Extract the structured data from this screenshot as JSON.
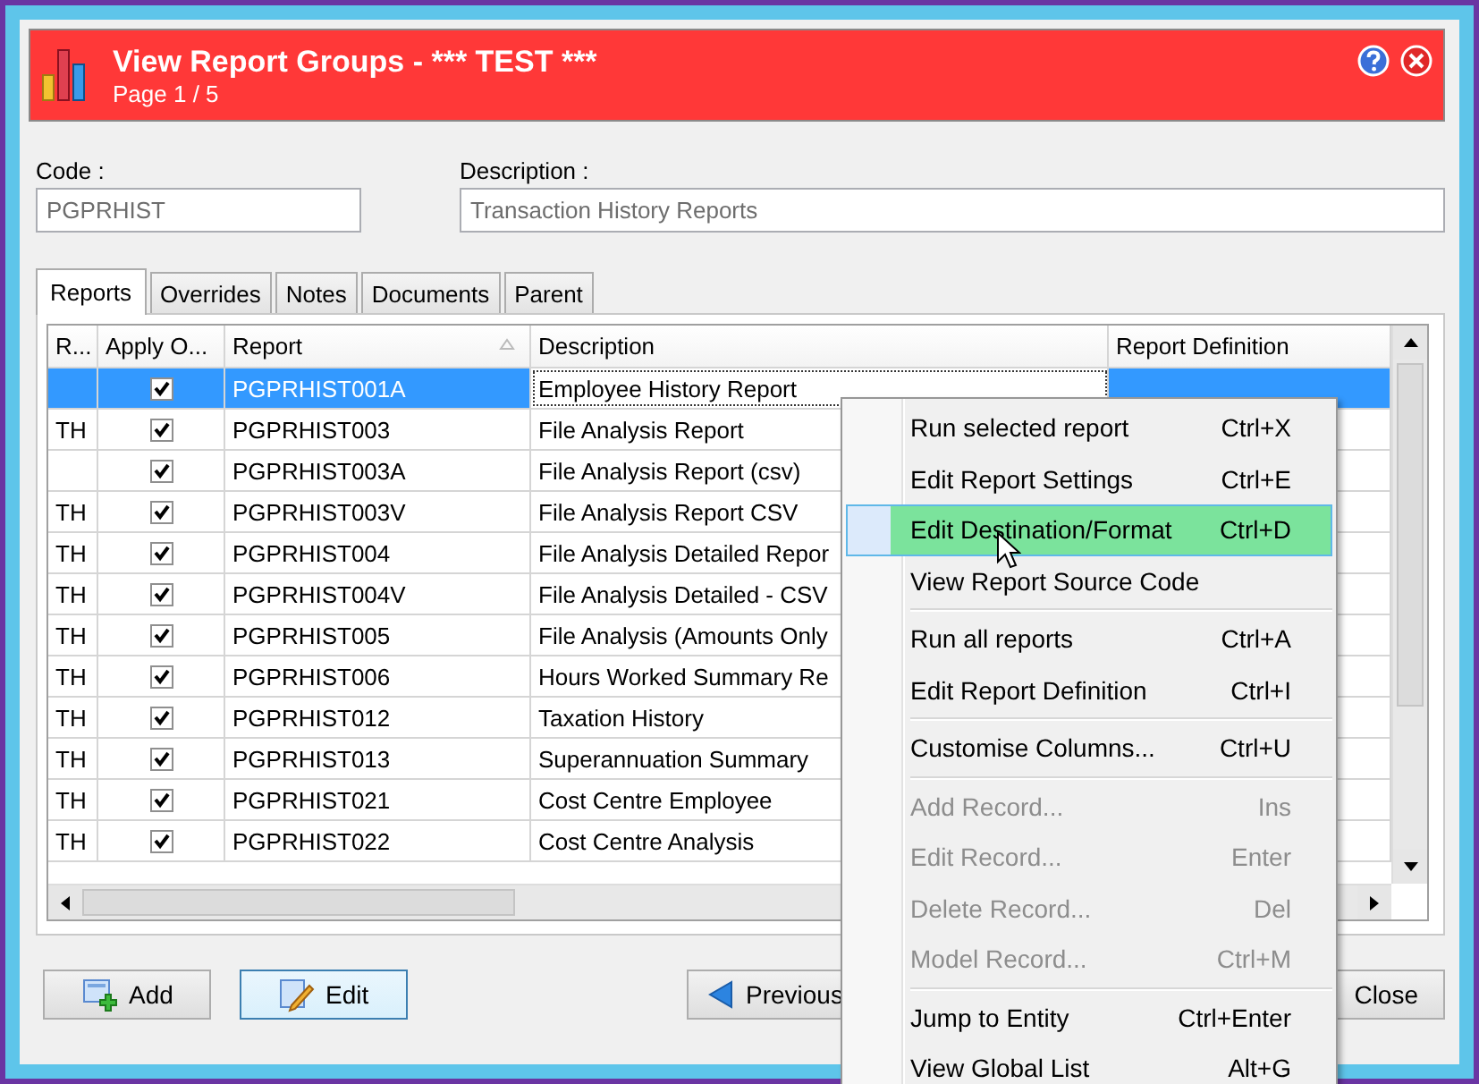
{
  "window": {
    "title": "View Report Groups - *** TEST ***",
    "subtitle": "Page 1 / 5"
  },
  "code": {
    "label": "Code :",
    "value": "PGPRHIST"
  },
  "description": {
    "label": "Description :",
    "value": "Transaction History Reports"
  },
  "tabs": [
    {
      "label": "Reports",
      "selected": true
    },
    {
      "label": "Overrides",
      "selected": false
    },
    {
      "label": "Notes",
      "selected": false
    },
    {
      "label": "Documents",
      "selected": false
    },
    {
      "label": "Parent",
      "selected": false
    }
  ],
  "table": {
    "columns": [
      "R...",
      "Apply O...",
      "Report",
      "Description",
      "Report Definition"
    ],
    "rows": [
      {
        "apply": true,
        "report": "PGPRHIST001A",
        "description": "Employee History Report",
        "selected": true
      },
      {
        "r": "TH",
        "apply": true,
        "report": "PGPRHIST003",
        "description": "File Analysis Report",
        "selected": false
      },
      {
        "apply": true,
        "report": "PGPRHIST003A",
        "description": "File Analysis Report (csv)",
        "selected": false
      },
      {
        "r": "TH",
        "apply": true,
        "report": "PGPRHIST003V",
        "description": "File Analysis Report CSV",
        "selected": false
      },
      {
        "r": "TH",
        "apply": true,
        "report": "PGPRHIST004",
        "description": "File Analysis Detailed Repor",
        "selected": false
      },
      {
        "r": "TH",
        "apply": true,
        "report": "PGPRHIST004V",
        "description": "File Analysis Detailed - CSV",
        "selected": false
      },
      {
        "r": "TH",
        "apply": true,
        "report": "PGPRHIST005",
        "description": "File Analysis (Amounts Only",
        "selected": false
      },
      {
        "r": "TH",
        "apply": true,
        "report": "PGPRHIST006",
        "description": "Hours Worked Summary Re",
        "selected": false
      },
      {
        "r": "TH",
        "apply": true,
        "report": "PGPRHIST012",
        "description": "Taxation History",
        "selected": false
      },
      {
        "r": "TH",
        "apply": true,
        "report": "PGPRHIST013",
        "description": "Superannuation Summary",
        "selected": false
      },
      {
        "r": "TH",
        "apply": true,
        "report": "PGPRHIST021",
        "description": "Cost Centre Employee",
        "selected": false
      },
      {
        "r": "TH",
        "apply": true,
        "report": "PGPRHIST022",
        "description": "Cost Centre Analysis",
        "selected": false
      }
    ]
  },
  "context_menu": [
    {
      "kind": "item",
      "label": "Run selected report",
      "shortcut": "Ctrl+X",
      "disabled": false,
      "selected": false
    },
    {
      "kind": "item",
      "label": "Edit Report Settings",
      "shortcut": "Ctrl+E",
      "disabled": false,
      "selected": false
    },
    {
      "kind": "item",
      "label": "Edit Destination/Format",
      "shortcut": "Ctrl+D",
      "disabled": false,
      "selected": true
    },
    {
      "kind": "item",
      "label": "View Report Source Code",
      "disabled": false,
      "selected": false
    },
    {
      "kind": "separator"
    },
    {
      "kind": "item",
      "label": "Run all reports",
      "shortcut": "Ctrl+A",
      "disabled": false,
      "selected": false
    },
    {
      "kind": "item",
      "label": "Edit Report Definition",
      "shortcut": "Ctrl+I",
      "disabled": false,
      "selected": false
    },
    {
      "kind": "separator"
    },
    {
      "kind": "item",
      "label": "Customise Columns...",
      "shortcut": "Ctrl+U",
      "disabled": false,
      "selected": false
    },
    {
      "kind": "separator"
    },
    {
      "kind": "item",
      "label": "Add Record...",
      "shortcut": "Ins",
      "disabled": true,
      "selected": false
    },
    {
      "kind": "item",
      "label": "Edit Record...",
      "shortcut": "Enter",
      "disabled": true,
      "selected": false
    },
    {
      "kind": "item",
      "label": "Delete Record...",
      "shortcut": "Del",
      "disabled": true,
      "selected": false
    },
    {
      "kind": "item",
      "label": "Model Record...",
      "shortcut": "Ctrl+M",
      "disabled": true,
      "selected": false
    },
    {
      "kind": "separator"
    },
    {
      "kind": "item",
      "label": "Jump to Entity",
      "shortcut": "Ctrl+Enter",
      "disabled": false,
      "selected": false
    },
    {
      "kind": "item",
      "label": "View Global List",
      "shortcut": "Alt+G",
      "disabled": false,
      "selected": false
    }
  ],
  "buttons": [
    {
      "kind": "add",
      "label": "Add",
      "focused": false
    },
    {
      "kind": "edit",
      "label": "Edit",
      "focused": true
    },
    {
      "kind": "previous",
      "label": "Previous",
      "focused": false
    },
    {
      "kind": "close",
      "label": "Close",
      "focused": false
    }
  ]
}
